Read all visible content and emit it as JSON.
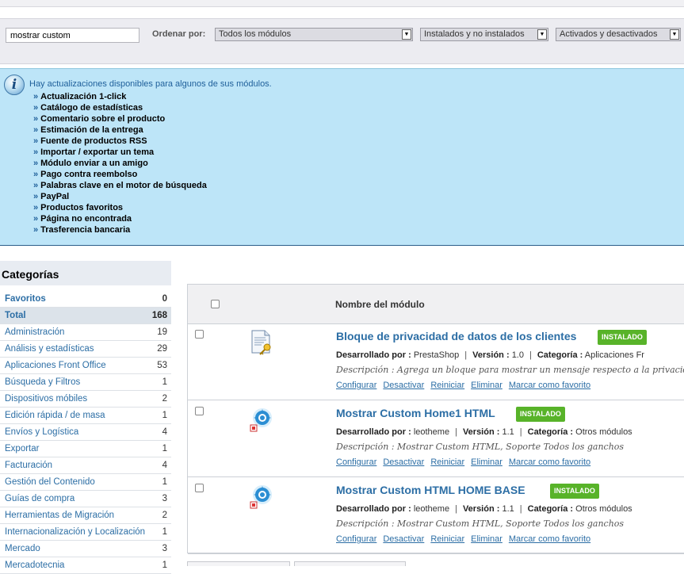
{
  "filters": {
    "search_value": "mostrar custom",
    "sort_label": "Ordenar por:",
    "module_filter": "Todos los módulos",
    "install_filter": "Instalados y no instalados",
    "status_filter": "Activados y desactivados"
  },
  "notice": {
    "title": "Hay actualizaciones disponibles para algunos de sus módulos.",
    "bullet": "»",
    "items": [
      "Actualización 1-click",
      "Catálogo de estadísticas",
      "Comentario sobre el producto",
      "Estimación de la entrega",
      "Fuente de productos RSS",
      "Importar / exportar un tema",
      "Módulo enviar a un amigo",
      "Pago contra reembolso",
      "Palabras clave en el motor de búsqueda",
      "PayPal",
      "Productos favoritos",
      "Página no encontrada",
      "Trasferencia bancaria"
    ]
  },
  "categories": {
    "title": "Categorías",
    "items": [
      {
        "label": "Favoritos",
        "count": "0"
      },
      {
        "label": "Total",
        "count": "168"
      },
      {
        "label": "Administración",
        "count": "19"
      },
      {
        "label": "Análisis y estadísticas",
        "count": "29"
      },
      {
        "label": "Aplicaciones Front Office",
        "count": "53"
      },
      {
        "label": "Búsqueda y Filtros",
        "count": "1"
      },
      {
        "label": "Dispositivos móbiles",
        "count": "2"
      },
      {
        "label": "Edición rápida / de masa",
        "count": "1"
      },
      {
        "label": "Envíos y Logística",
        "count": "4"
      },
      {
        "label": "Exportar",
        "count": "1"
      },
      {
        "label": "Facturación",
        "count": "4"
      },
      {
        "label": "Gestión del Contenido",
        "count": "1"
      },
      {
        "label": "Guías de compra",
        "count": "3"
      },
      {
        "label": "Herramientas de Migración",
        "count": "2"
      },
      {
        "label": "Internacionalización y Localización",
        "count": "1"
      },
      {
        "label": "Mercado",
        "count": "3"
      },
      {
        "label": "Mercadotecnia",
        "count": "1"
      }
    ]
  },
  "table": {
    "header": "Nombre del módulo",
    "labels": {
      "developer": "Desarrollado por :",
      "version": "Versión :",
      "category": "Categoría :",
      "description": "Descripción :"
    },
    "actions": [
      "Configurar",
      "Desactivar",
      "Reiniciar",
      "Eliminar",
      "Marcar como favorito"
    ],
    "modules": [
      {
        "name": "Bloque de privacidad de datos de los clientes",
        "status": "INSTALADO",
        "developer": "PrestaShop",
        "version": "1.0",
        "category": "Aplicaciones Fr",
        "description": "Agrega un bloque para mostrar un mensaje respecto a la privacidad",
        "icon": "document-key-icon"
      },
      {
        "name": "Mostrar Custom Home1 HTML",
        "status": "INSTALADO",
        "developer": "leotheme",
        "version": "1.1",
        "category": "Otros módulos",
        "description": "Mostrar Custom HTML, Soporte Todos los ganchos",
        "icon": "leotheme-gear-icon"
      },
      {
        "name": "Mostrar Custom HTML HOME BASE",
        "status": "INSTALADO",
        "developer": "leotheme",
        "version": "1.1",
        "category": "Otros módulos",
        "description": "Mostrar Custom HTML, Soporte Todos los ganchos",
        "icon": "leotheme-gear-icon"
      }
    ]
  }
}
